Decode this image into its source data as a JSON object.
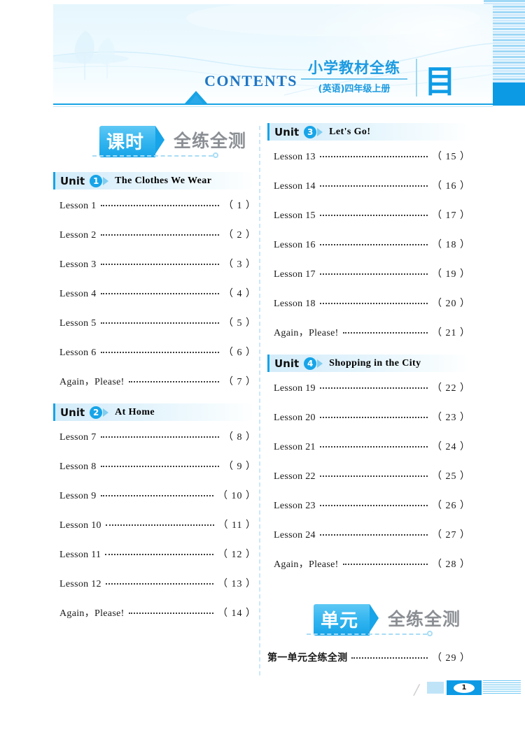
{
  "header": {
    "contents_word": "CONTENTS",
    "brand_main": "小学教材全练",
    "brand_sub": "(英语)四年级上册",
    "mulu": "目 录"
  },
  "columns": {
    "left": {
      "badge": {
        "tag": "课时",
        "sub": "全练全测"
      },
      "units": [
        {
          "word": "Unit",
          "number": "1",
          "title": "The Clothes We Wear",
          "entries": [
            {
              "label": "Lesson 1",
              "page": "（ 1 ）"
            },
            {
              "label": "Lesson 2",
              "page": "（ 2 ）"
            },
            {
              "label": "Lesson 3",
              "page": "（ 3 ）"
            },
            {
              "label": "Lesson 4",
              "page": "（ 4 ）"
            },
            {
              "label": "Lesson 5",
              "page": "（ 5 ）"
            },
            {
              "label": "Lesson 6",
              "page": "（ 6 ）"
            },
            {
              "label": "Again，Please!",
              "page": "（ 7 ）"
            }
          ]
        },
        {
          "word": "Unit",
          "number": "2",
          "title": "At Home",
          "entries": [
            {
              "label": "Lesson 7",
              "page": "（ 8 ）"
            },
            {
              "label": "Lesson 8",
              "page": "（ 9 ）"
            },
            {
              "label": "Lesson 9",
              "page": "（ 10 ）"
            },
            {
              "label": "Lesson 10",
              "page": "（ 11 ）"
            },
            {
              "label": "Lesson 11",
              "page": "（ 12 ）"
            },
            {
              "label": "Lesson 12",
              "page": "（ 13 ）"
            },
            {
              "label": "Again，Please!",
              "page": "（ 14 ）"
            }
          ]
        }
      ]
    },
    "right": {
      "units": [
        {
          "word": "Unit",
          "number": "3",
          "title": "Let's Go!",
          "entries": [
            {
              "label": "Lesson 13",
              "page": "（ 15 ）"
            },
            {
              "label": "Lesson 14",
              "page": "（ 16 ）"
            },
            {
              "label": "Lesson 15",
              "page": "（ 17 ）"
            },
            {
              "label": "Lesson 16",
              "page": "（ 18 ）"
            },
            {
              "label": "Lesson 17",
              "page": "（ 19 ）"
            },
            {
              "label": "Lesson 18",
              "page": "（ 20 ）"
            },
            {
              "label": "Again，Please!",
              "page": "（ 21 ）"
            }
          ]
        },
        {
          "word": "Unit",
          "number": "4",
          "title": "Shopping in the City",
          "entries": [
            {
              "label": "Lesson 19",
              "page": "（ 22 ）"
            },
            {
              "label": "Lesson 20",
              "page": "（ 23 ）"
            },
            {
              "label": "Lesson 21",
              "page": "（ 24 ）"
            },
            {
              "label": "Lesson 22",
              "page": "（ 25 ）"
            },
            {
              "label": "Lesson 23",
              "page": "（ 26 ）"
            },
            {
              "label": "Lesson 24",
              "page": "（ 27 ）"
            },
            {
              "label": "Again，Please!",
              "page": "（ 28 ）"
            }
          ]
        }
      ],
      "badge": {
        "tag": "单元",
        "sub": "全练全测"
      },
      "unit_test_entries": [
        {
          "label": "第一单元全练全测",
          "page": "（ 29 ）"
        }
      ]
    }
  },
  "footer": {
    "page_number": "1"
  },
  "colors": {
    "accent_blue": "#0d9ae5",
    "light_blue": "#bfe4f8",
    "contents_blue": "#1f76c4",
    "badge_gray": "#8b8f94"
  }
}
